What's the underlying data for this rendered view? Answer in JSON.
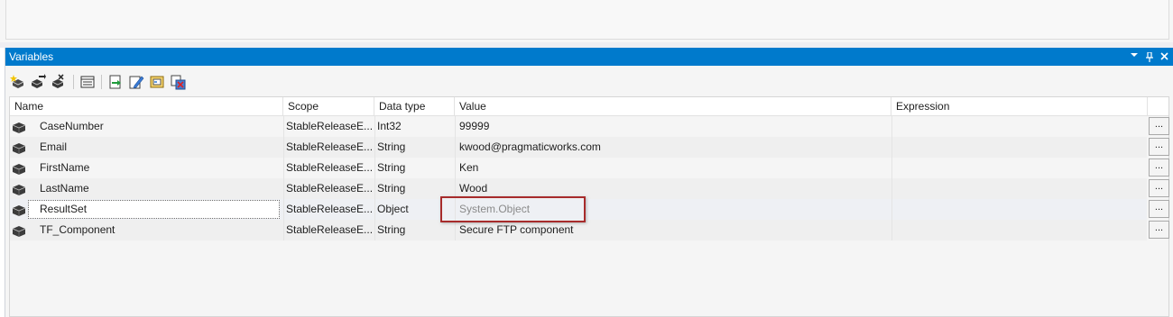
{
  "window": {
    "title": "Variables"
  },
  "toolbar": {
    "buttons": [
      {
        "icon": "add-variable-icon"
      },
      {
        "icon": "move-variable-icon"
      },
      {
        "icon": "delete-variable-icon"
      },
      {
        "icon": "grid-options-icon"
      },
      {
        "icon": "expression-icon"
      },
      {
        "icon": "edit-expression-icon"
      },
      {
        "icon": "evaluate-icon"
      },
      {
        "icon": "parameterize-icon"
      }
    ]
  },
  "grid": {
    "columns": {
      "name": "Name",
      "scope": "Scope",
      "data_type": "Data type",
      "value": "Value",
      "expression": "Expression"
    },
    "rows": [
      {
        "name": "CaseNumber",
        "scope": "StableReleaseE...",
        "data_type": "Int32",
        "value": "99999",
        "expression": ""
      },
      {
        "name": "Email",
        "scope": "StableReleaseE...",
        "data_type": "String",
        "value": "kwood@pragmaticworks.com",
        "expression": ""
      },
      {
        "name": "FirstName",
        "scope": "StableReleaseE...",
        "data_type": "String",
        "value": "Ken",
        "expression": ""
      },
      {
        "name": "LastName",
        "scope": "StableReleaseE...",
        "data_type": "String",
        "value": "Wood",
        "expression": ""
      },
      {
        "name": "ResultSet",
        "scope": "StableReleaseE...",
        "data_type": "Object",
        "value": "System.Object",
        "expression": ""
      },
      {
        "name": "TF_Component",
        "scope": "StableReleaseE...",
        "data_type": "String",
        "value": "Secure FTP component",
        "expression": ""
      }
    ],
    "ellipsis_label": "..."
  },
  "colors": {
    "title_bar": "#007acc",
    "highlight": "#a72b2b"
  }
}
